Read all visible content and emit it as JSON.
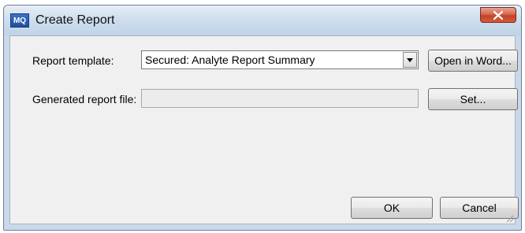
{
  "window": {
    "title": "Create Report",
    "icon_label": "MQ",
    "icon": "app-icon",
    "close_icon": "close-icon"
  },
  "form": {
    "template_label": "Report template:",
    "template_value": "Secured: Analyte Report Summary",
    "generated_label": "Generated report file:",
    "generated_value": ""
  },
  "buttons": {
    "open_in_word": "Open in Word...",
    "set": "Set...",
    "ok": "OK",
    "cancel": "Cancel"
  },
  "colors": {
    "titlebar": "#cfdeee",
    "close_button": "#c24428",
    "client_bg": "#f0f0f0"
  }
}
